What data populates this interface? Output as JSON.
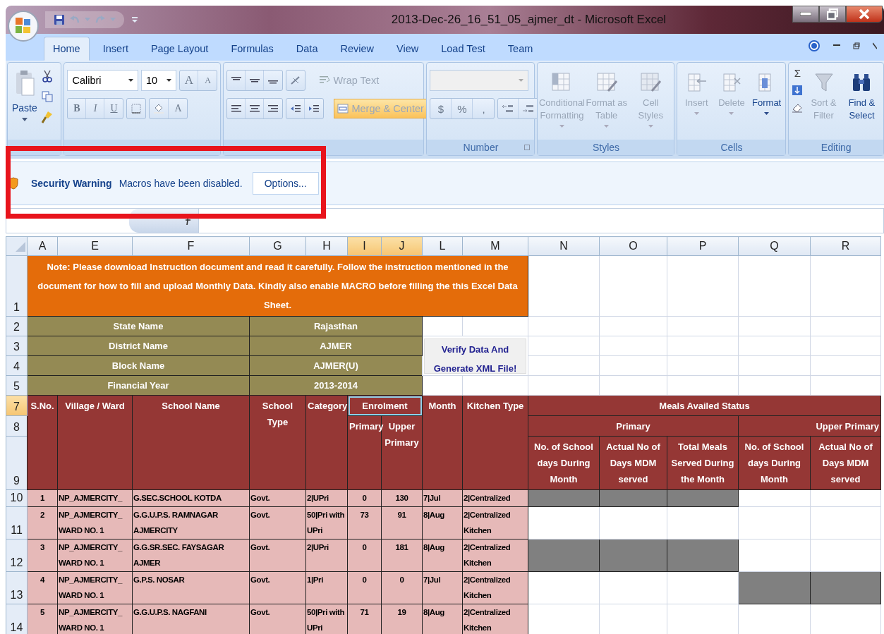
{
  "window": {
    "title": "2013-Dec-26_16_51_05_ajmer_dt - Microsoft Excel"
  },
  "tabs": [
    {
      "label": "Home",
      "selected": true
    },
    {
      "label": "Insert",
      "selected": false
    },
    {
      "label": "Page Layout",
      "selected": false
    },
    {
      "label": "Formulas",
      "selected": false
    },
    {
      "label": "Data",
      "selected": false
    },
    {
      "label": "Review",
      "selected": false
    },
    {
      "label": "View",
      "selected": false
    },
    {
      "label": "Load Test",
      "selected": false
    },
    {
      "label": "Team",
      "selected": false
    }
  ],
  "ribbon": {
    "clipboard": {
      "paste": "Paste"
    },
    "font": {
      "font_name": "Calibri",
      "font_size": "10",
      "grow": "A",
      "shrink": "A",
      "bold": "B",
      "italic": "I",
      "underline": "U",
      "font_color": "A"
    },
    "alignment": {
      "buttons": [
        {
          "label": "Wrap Text",
          "disabled": true,
          "pressed": false
        },
        {
          "label": "Merge & Center",
          "disabled": true,
          "pressed": true
        }
      ]
    },
    "number": {
      "label": "Number",
      "symbols": [
        "$",
        "%",
        ","
      ]
    },
    "styles": {
      "label": "Styles",
      "buttons": [
        {
          "label": "Conditional Formatting",
          "disabled": true,
          "kind": "conditional"
        },
        {
          "label": "Format as Table",
          "disabled": true,
          "kind": "table"
        },
        {
          "label": "Cell Styles",
          "disabled": true,
          "kind": "styles"
        }
      ]
    },
    "cells": {
      "label": "Cells",
      "buttons": [
        {
          "label": "Insert",
          "disabled": true,
          "kind": "insert"
        },
        {
          "label": "Delete",
          "disabled": true,
          "kind": "delete"
        },
        {
          "label": "Format",
          "disabled": false,
          "kind": "format"
        }
      ]
    },
    "editing": {
      "label": "Editing",
      "sum": "Σ",
      "buttons": [
        {
          "label": "Sort & Filter",
          "disabled": true,
          "kind": "sort"
        },
        {
          "label": "Find & Select",
          "disabled": false,
          "kind": "find"
        }
      ]
    }
  },
  "security_bar": {
    "title": "Security Warning",
    "message": "Macros have been disabled.",
    "button": "Options..."
  },
  "sheet": {
    "columns": [
      {
        "label": "A",
        "selected": false
      },
      {
        "label": "E",
        "selected": false
      },
      {
        "label": "F",
        "selected": false
      },
      {
        "label": "G",
        "selected": false
      },
      {
        "label": "H",
        "selected": false
      },
      {
        "label": "I",
        "selected": true
      },
      {
        "label": "J",
        "selected": true
      },
      {
        "label": "L",
        "selected": false
      },
      {
        "label": "M",
        "selected": false
      },
      {
        "label": "N",
        "selected": false
      },
      {
        "label": "O",
        "selected": false
      },
      {
        "label": "P",
        "selected": false
      },
      {
        "label": "Q",
        "selected": false
      },
      {
        "label": "R",
        "selected": false
      }
    ],
    "row_headers": [
      {
        "label": "1",
        "selected": false
      },
      {
        "label": "2",
        "selected": false
      },
      {
        "label": "3",
        "selected": false
      },
      {
        "label": "4",
        "selected": false
      },
      {
        "label": "5",
        "selected": false
      },
      {
        "label": "7",
        "selected": true
      },
      {
        "label": "8",
        "selected": false
      },
      {
        "label": "9",
        "selected": false
      },
      {
        "label": "10",
        "selected": false
      },
      {
        "label": "11",
        "selected": false
      },
      {
        "label": "12",
        "selected": false
      },
      {
        "label": "13",
        "selected": false
      },
      {
        "label": "14",
        "selected": false
      }
    ],
    "note": "Note: Please download Instruction document and read it carefully.  Follow the instruction mentioned in the document for how to fill and upload Monthly Data. Kindly also enable MACRO before filling the this Excel Data Sheet.",
    "info": [
      {
        "label": "State Name",
        "value": "Rajasthan"
      },
      {
        "label": "District Name",
        "value": "AJMER"
      },
      {
        "label": "Block Name",
        "value": "AJMER(U)"
      },
      {
        "label": "Financial Year",
        "value": "2013-2014"
      }
    ],
    "verify_button": "Verify Data And Generate XML File!",
    "header": {
      "sno": "S.No.",
      "village": "Village / Ward",
      "school": "School Name",
      "school_type": "School Type",
      "category": "Category",
      "enrolment": {
        "label": "Enrolment",
        "selected": true
      },
      "enrol_primary": "Primary",
      "enrol_upper": "Upper Primary",
      "month": "Month",
      "kitchen": "Kitchen Type",
      "meals": "Meals Availed Status",
      "meals_primary": "Primary",
      "meals_upper": "Upper Primary",
      "meals_columns": [
        "No. of School days During Month",
        "Actual No of Days MDM served",
        "Total Meals Served During the Month",
        "No. of School days During Month",
        "Actual No of Days MDM served"
      ]
    },
    "rows": [
      {
        "sno": "1",
        "village": "NP_AJMERCITY_",
        "school": "G.SEC.SCHOOL KOTDA",
        "type": "Govt.",
        "category": "2|UPri",
        "primary": "0",
        "upper_primary": "130",
        "month": "7|Jul",
        "kitchen": "2|Centralized",
        "meals_shaded": [
          true,
          true,
          true,
          false,
          false
        ]
      },
      {
        "sno": "2",
        "village": "NP_AJMERCITY_ WARD NO. 1",
        "school": "G.G.U.P.S. RAMNAGAR AJMERCITY",
        "type": "Govt.",
        "category": "50|Pri with UPri",
        "primary": "73",
        "upper_primary": "91",
        "month": "8|Aug",
        "kitchen": "2|Centralized Kitchen",
        "meals_shaded": [
          false,
          false,
          false,
          false,
          false
        ]
      },
      {
        "sno": "3",
        "village": "NP_AJMERCITY_ WARD NO. 1",
        "school": "G.G.SR.SEC. FAYSAGAR AJMER",
        "type": "Govt.",
        "category": "2|UPri",
        "primary": "0",
        "upper_primary": "181",
        "month": "8|Aug",
        "kitchen": "2|Centralized Kitchen",
        "meals_shaded": [
          true,
          true,
          true,
          false,
          false
        ]
      },
      {
        "sno": "4",
        "village": "NP_AJMERCITY_ WARD NO. 1",
        "school": "G.P.S. NOSAR",
        "type": "Govt.",
        "category": "1|Pri",
        "primary": "0",
        "upper_primary": "0",
        "month": "7|Jul",
        "kitchen": "2|Centralized Kitchen",
        "meals_shaded": [
          false,
          false,
          false,
          true,
          true
        ]
      },
      {
        "sno": "5",
        "village": "NP_AJMERCITY_ WARD NO. 1",
        "school": "G.G.U.P.S. NAGFANI",
        "type": "Govt.",
        "category": "50|Pri with UPri",
        "primary": "71",
        "upper_primary": "19",
        "month": "8|Aug",
        "kitchen": "2|Centralized Kitchen",
        "meals_shaded": [
          false,
          false,
          false,
          false,
          false
        ]
      }
    ]
  }
}
